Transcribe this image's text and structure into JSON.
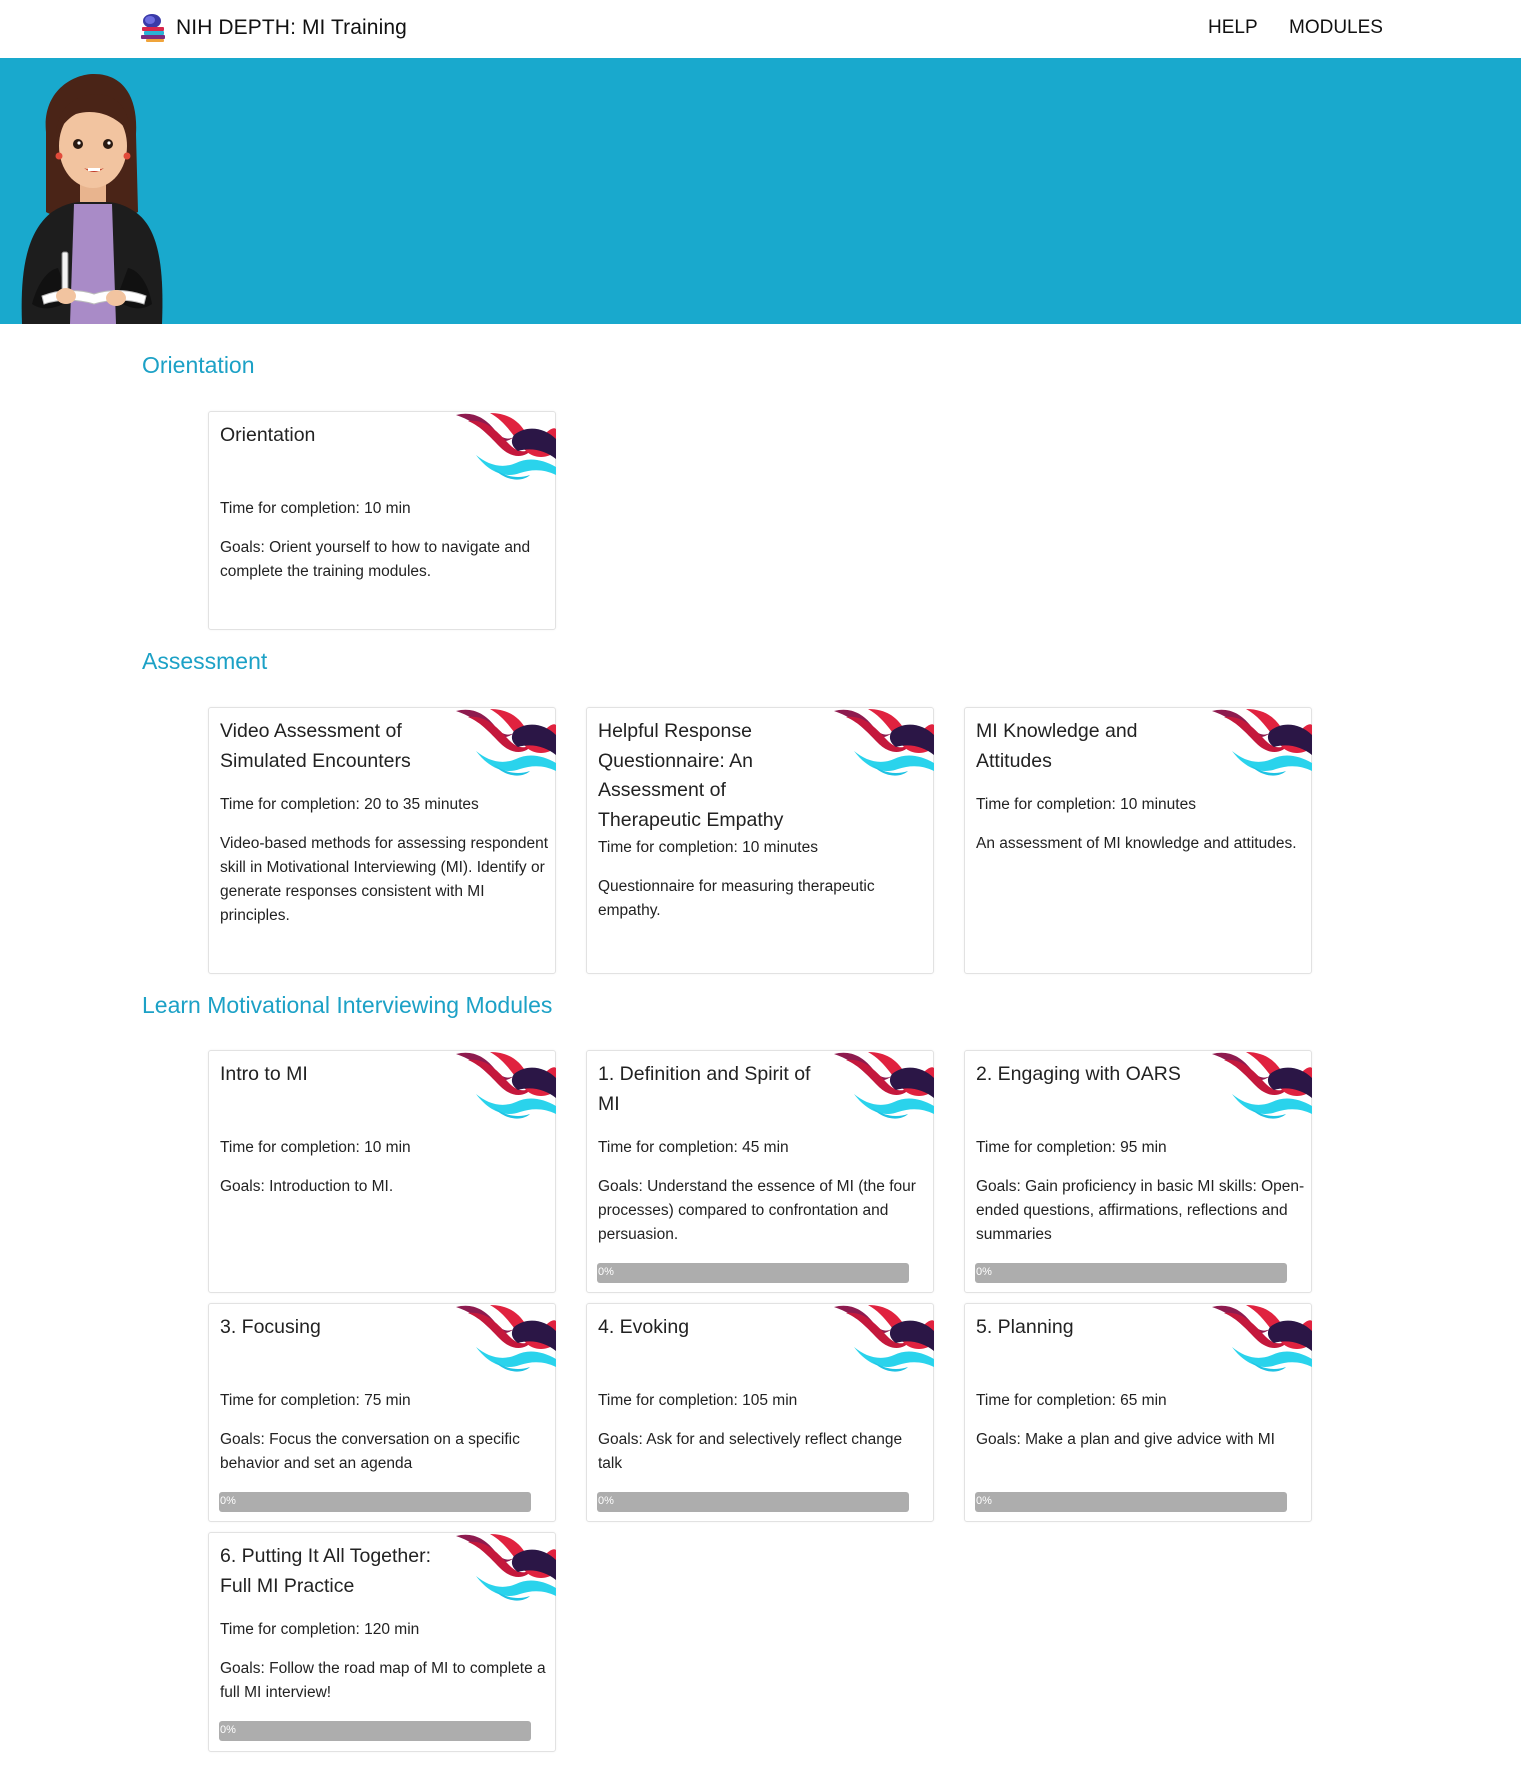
{
  "brand": {
    "title": "NIH DEPTH: MI Training",
    "logo_icon": "brain-books-icon"
  },
  "nav": {
    "help": "HELP",
    "modules": "MODULES"
  },
  "colors": {
    "hero": "#19a9cd",
    "section_title": "#1ca1c6",
    "progress_track": "#adadad"
  },
  "sections": {
    "orientation": {
      "title": "Orientation",
      "cards": [
        {
          "title": "Orientation",
          "time": "Time for completion: 10 min",
          "goals": "Goals: Orient yourself to how to navigate and complete the training modules."
        }
      ]
    },
    "assessment": {
      "title": "Assessment",
      "cards": [
        {
          "title": "Video Assessment of Simulated Encounters",
          "time": "Time for completion: 20 to 35 minutes",
          "goals": "Video-based methods for assessing respondent skill in Motivational Interviewing (MI). Identify or generate responses consistent with MI principles."
        },
        {
          "title": "Helpful Response Questionnaire: An Assessment of Therapeutic Empathy",
          "time": "Time for completion: 10 minutes",
          "goals": "Questionnaire for measuring therapeutic empathy."
        },
        {
          "title": "MI Knowledge and Attitudes",
          "time": "Time for completion: 10 minutes",
          "goals": "An assessment of MI knowledge and attitudes."
        }
      ]
    },
    "learn": {
      "title": "Learn Motivational Interviewing Modules",
      "cards": [
        {
          "title": "Intro to MI",
          "time": "Time for completion: 10 min",
          "goals": "Goals: Introduction to MI."
        },
        {
          "title": "1. Definition and Spirit of MI",
          "time": "Time for completion: 45 min",
          "goals": "Goals: Understand the essence of MI (the four processes) compared to confrontation and persuasion.",
          "progress": 0,
          "progress_label": "0%"
        },
        {
          "title": "2. Engaging with OARS",
          "time": "Time for completion: 95 min",
          "goals": "Goals: Gain proficiency in basic MI skills: Open-ended questions, affirmations, reflections and summaries",
          "progress": 0,
          "progress_label": "0%"
        },
        {
          "title": "3. Focusing",
          "time": "Time for completion: 75 min",
          "goals": "Goals: Focus the conversation on a specific behavior and set an agenda",
          "progress": 0,
          "progress_label": "0%"
        },
        {
          "title": "4. Evoking",
          "time": "Time for completion: 105 min",
          "goals": "Goals: Ask for and selectively reflect change talk",
          "progress": 0,
          "progress_label": "0%"
        },
        {
          "title": "5. Planning",
          "time": "Time for completion: 65 min",
          "goals": "Goals: Make a plan and give advice with MI",
          "progress": 0,
          "progress_label": "0%"
        },
        {
          "title": "6. Putting It All Together: Full MI Practice",
          "time": "Time for completion: 120 min",
          "goals": "Goals: Follow the road map of MI to complete a full MI interview!",
          "progress": 0,
          "progress_label": "0%"
        }
      ]
    }
  }
}
